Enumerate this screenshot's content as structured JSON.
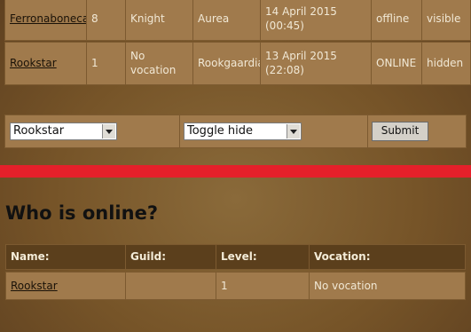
{
  "players": [
    {
      "name": "Ferronaboneca",
      "level": "8",
      "vocation": "Knight",
      "world": "Aurea",
      "last_login": "14 April 2015 (00:45)",
      "status": "offline",
      "visibility": "visible"
    },
    {
      "name": "Rookstar",
      "level": "1",
      "vocation": "No vocation",
      "world": "Rookgaardia",
      "last_login": "13 April 2015 (22:08)",
      "status": "ONLINE",
      "visibility": "hidden"
    }
  ],
  "form": {
    "character_select": "Rookstar",
    "action_select": "Toggle hide",
    "submit_label": "Submit"
  },
  "divider_color": "#e5202a",
  "online": {
    "title": "Who is online?",
    "headers": [
      "Name:",
      "Guild:",
      "Level:",
      "Vocation:"
    ],
    "rows": [
      {
        "name": "Rookstar",
        "guild": "",
        "level": "1",
        "vocation": "No vocation"
      }
    ]
  }
}
